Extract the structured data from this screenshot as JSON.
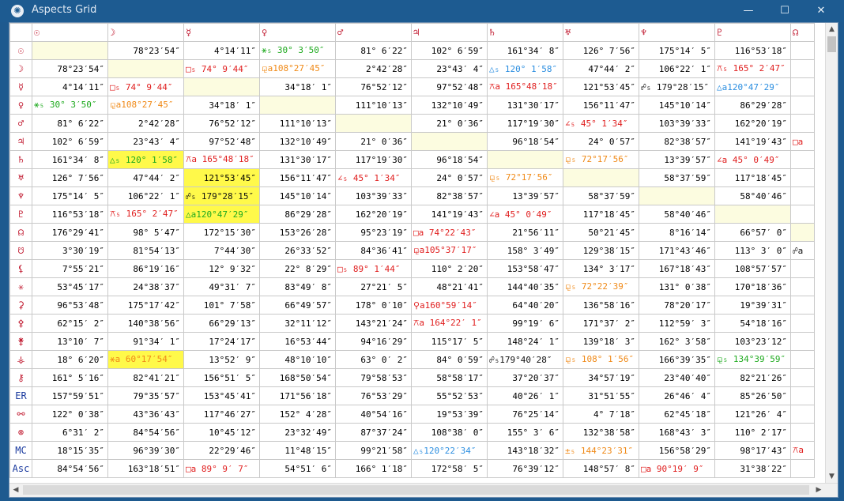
{
  "window": {
    "title": "Aspects Grid",
    "minimize": "—",
    "maximize": "☐",
    "close": "✕"
  },
  "colors": {
    "green": "#1faa1f",
    "red": "#e01e1e",
    "blue": "#2b8ee0",
    "orange": "#f08a18",
    "highlight": "#fff94a",
    "diagonal": "#fcfce0"
  },
  "columns": [
    "☉",
    "☽",
    "☿",
    "♀",
    "♂",
    "♃",
    "♄",
    "♅",
    "♆",
    "♇",
    "☊"
  ],
  "rows": [
    {
      "h": "☉",
      "c": [
        {
          "e": 1
        },
        {
          "t": "78°23′54″"
        },
        {
          "t": "4°14′11″"
        },
        {
          "t": "⚹₅ 30° 3′50″",
          "k": "green",
          "a": 1
        },
        {
          "t": "81° 6′22″"
        },
        {
          "t": "102° 6′59″"
        },
        {
          "t": "161°34′ 8″"
        },
        {
          "t": "126° 7′56″"
        },
        {
          "t": "175°14′ 5″"
        },
        {
          "t": "116°53′18″"
        },
        {
          "t": ""
        }
      ]
    },
    {
      "h": "☽",
      "c": [
        {
          "t": "78°23′54″"
        },
        {
          "e": 1
        },
        {
          "t": "□₅ 74° 9′44″",
          "k": "red",
          "a": 1
        },
        {
          "t": "⚼a108°27′45″",
          "k": "orange",
          "a": 1
        },
        {
          "t": "2°42′28″"
        },
        {
          "t": "23°43′ 4″"
        },
        {
          "t": "△₅ 120° 1′58″",
          "k": "blue",
          "a": 1
        },
        {
          "t": "47°44′ 2″"
        },
        {
          "t": "106°22′ 1″"
        },
        {
          "t": "⚻₅ 165° 2′47″",
          "k": "red",
          "a": 1
        },
        {
          "t": ""
        }
      ]
    },
    {
      "h": "☿",
      "c": [
        {
          "t": "4°14′11″"
        },
        {
          "t": "□₅ 74° 9′44″",
          "k": "red",
          "a": 1
        },
        {
          "e": 1
        },
        {
          "t": "34°18′ 1″"
        },
        {
          "t": "76°52′12″"
        },
        {
          "t": "97°52′48″"
        },
        {
          "t": "⚻a 165°48′18″",
          "k": "red",
          "a": 1
        },
        {
          "t": "121°53′45″"
        },
        {
          "t": "☍₅ 179°28′15″",
          "k": "black",
          "a": 1
        },
        {
          "t": "△a120°47′29″",
          "k": "blue",
          "a": 1
        },
        {
          "t": ""
        }
      ]
    },
    {
      "h": "♀",
      "c": [
        {
          "t": "⚹₅ 30° 3′50″",
          "k": "green",
          "a": 1
        },
        {
          "t": "⚼a108°27′45″",
          "k": "orange",
          "a": 1
        },
        {
          "t": "34°18′ 1″"
        },
        {
          "e": 1
        },
        {
          "t": "111°10′13″"
        },
        {
          "t": "132°10′49″"
        },
        {
          "t": "131°30′17″"
        },
        {
          "t": "156°11′47″"
        },
        {
          "t": "145°10′14″"
        },
        {
          "t": "86°29′28″"
        },
        {
          "t": ""
        }
      ]
    },
    {
      "h": "♂",
      "c": [
        {
          "t": "81° 6′22″"
        },
        {
          "t": "2°42′28″"
        },
        {
          "t": "76°52′12″"
        },
        {
          "t": "111°10′13″"
        },
        {
          "e": 1
        },
        {
          "t": "21° 0′36″"
        },
        {
          "t": "117°19′30″"
        },
        {
          "t": "∠₅ 45° 1′34″",
          "k": "red",
          "a": 1
        },
        {
          "t": "103°39′33″"
        },
        {
          "t": "162°20′19″"
        },
        {
          "t": ""
        }
      ]
    },
    {
      "h": "♃",
      "c": [
        {
          "t": "102° 6′59″"
        },
        {
          "t": "23°43′ 4″"
        },
        {
          "t": "97°52′48″"
        },
        {
          "t": "132°10′49″"
        },
        {
          "t": "21° 0′36″"
        },
        {
          "e": 1
        },
        {
          "t": "96°18′54″"
        },
        {
          "t": "24° 0′57″"
        },
        {
          "t": "82°38′57″"
        },
        {
          "t": "141°19′43″"
        },
        {
          "t": "□a",
          "k": "red",
          "a": 1
        }
      ]
    },
    {
      "h": "♄",
      "c": [
        {
          "t": "161°34′ 8″"
        },
        {
          "t": "△₅ 120° 1′58″",
          "k": "green",
          "a": 1,
          "hl": 1
        },
        {
          "t": "⚻a 165°48′18″",
          "k": "red",
          "a": 1
        },
        {
          "t": "131°30′17″"
        },
        {
          "t": "117°19′30″"
        },
        {
          "t": "96°18′54″"
        },
        {
          "e": 1
        },
        {
          "t": "⚼₅ 72°17′56″",
          "k": "orange",
          "a": 1
        },
        {
          "t": "13°39′57″"
        },
        {
          "t": "∠a 45° 0′49″",
          "k": "red",
          "a": 1
        },
        {
          "t": ""
        }
      ]
    },
    {
      "h": "♅",
      "c": [
        {
          "t": "126° 7′56″"
        },
        {
          "t": "47°44′ 2″"
        },
        {
          "t": "121°53′45″",
          "hl": 1
        },
        {
          "t": "156°11′47″"
        },
        {
          "t": "∠₅ 45° 1′34″",
          "k": "red",
          "a": 1
        },
        {
          "t": "24° 0′57″"
        },
        {
          "t": "⚼₅ 72°17′56″",
          "k": "orange",
          "a": 1
        },
        {
          "e": 1
        },
        {
          "t": "58°37′59″"
        },
        {
          "t": "117°18′45″"
        },
        {
          "t": ""
        }
      ]
    },
    {
      "h": "♆",
      "c": [
        {
          "t": "175°14′ 5″"
        },
        {
          "t": "106°22′ 1″"
        },
        {
          "t": "☍₅ 179°28′15″",
          "k": "black",
          "a": 1,
          "hl": 1
        },
        {
          "t": "145°10′14″"
        },
        {
          "t": "103°39′33″"
        },
        {
          "t": "82°38′57″"
        },
        {
          "t": "13°39′57″"
        },
        {
          "t": "58°37′59″"
        },
        {
          "e": 1
        },
        {
          "t": "58°40′46″"
        },
        {
          "t": ""
        }
      ]
    },
    {
      "h": "♇",
      "c": [
        {
          "t": "116°53′18″"
        },
        {
          "t": "⚻₅ 165° 2′47″",
          "k": "red",
          "a": 1
        },
        {
          "t": "△a120°47′29″",
          "k": "green",
          "a": 1,
          "hl": 1
        },
        {
          "t": "86°29′28″"
        },
        {
          "t": "162°20′19″"
        },
        {
          "t": "141°19′43″"
        },
        {
          "t": "∠a 45° 0′49″",
          "k": "red",
          "a": 1
        },
        {
          "t": "117°18′45″"
        },
        {
          "t": "58°40′46″"
        },
        {
          "e": 1
        },
        {
          "t": ""
        }
      ]
    },
    {
      "h": "☊",
      "c": [
        {
          "t": "176°29′41″"
        },
        {
          "t": "98° 5′47″"
        },
        {
          "t": "172°15′30″"
        },
        {
          "t": "153°26′28″"
        },
        {
          "t": "95°23′19″"
        },
        {
          "t": "□a 74°22′43″",
          "k": "red",
          "a": 1
        },
        {
          "t": "21°56′11″"
        },
        {
          "t": "50°21′45″"
        },
        {
          "t": "8°16′14″"
        },
        {
          "t": "66°57′ 0″"
        },
        {
          "e": 1
        }
      ]
    },
    {
      "h": "☋",
      "c": [
        {
          "t": "3°30′19″"
        },
        {
          "t": "81°54′13″"
        },
        {
          "t": "7°44′30″"
        },
        {
          "t": "26°33′52″"
        },
        {
          "t": "84°36′41″"
        },
        {
          "t": "⚼a105°37′17″",
          "k": "red",
          "a": 1
        },
        {
          "t": "158° 3′49″"
        },
        {
          "t": "129°38′15″"
        },
        {
          "t": "171°43′46″"
        },
        {
          "t": "113° 3′ 0″"
        },
        {
          "t": "☍a",
          "k": "black",
          "a": 1
        }
      ]
    },
    {
      "h": "⚸",
      "c": [
        {
          "t": "7°55′21″"
        },
        {
          "t": "86°19′16″"
        },
        {
          "t": "12° 9′32″"
        },
        {
          "t": "22° 8′29″"
        },
        {
          "t": "□₅ 89° 1′44″",
          "k": "red",
          "a": 1
        },
        {
          "t": "110° 2′20″"
        },
        {
          "t": "153°58′47″"
        },
        {
          "t": "134° 3′17″"
        },
        {
          "t": "167°18′43″"
        },
        {
          "t": "108°57′57″"
        },
        {
          "t": ""
        }
      ]
    },
    {
      "h": "✳",
      "c": [
        {
          "t": "53°45′17″"
        },
        {
          "t": "24°38′37″"
        },
        {
          "t": "49°31′ 7″"
        },
        {
          "t": "83°49′ 8″"
        },
        {
          "t": "27°21′ 5″"
        },
        {
          "t": "48°21′41″"
        },
        {
          "t": "144°40′35″"
        },
        {
          "t": "⚼₅ 72°22′39″",
          "k": "orange",
          "a": 1
        },
        {
          "t": "131° 0′38″"
        },
        {
          "t": "170°18′36″"
        },
        {
          "t": ""
        }
      ]
    },
    {
      "h": "⚳",
      "c": [
        {
          "t": "96°53′48″"
        },
        {
          "t": "175°17′42″"
        },
        {
          "t": "101° 7′58″"
        },
        {
          "t": "66°49′57″"
        },
        {
          "t": "178° 0′10″"
        },
        {
          "t": "⚲a160°59′14″",
          "k": "red",
          "a": 1
        },
        {
          "t": "64°40′20″"
        },
        {
          "t": "136°58′16″"
        },
        {
          "t": "78°20′17″"
        },
        {
          "t": "19°39′31″"
        },
        {
          "t": ""
        }
      ]
    },
    {
      "h": "⚴",
      "c": [
        {
          "t": "62°15′ 2″"
        },
        {
          "t": "140°38′56″"
        },
        {
          "t": "66°29′13″"
        },
        {
          "t": "32°11′12″"
        },
        {
          "t": "143°21′24″"
        },
        {
          "t": "⚻a 164°22′ 1″",
          "k": "red",
          "a": 1
        },
        {
          "t": "99°19′ 6″"
        },
        {
          "t": "171°37′ 2″"
        },
        {
          "t": "112°59′ 3″"
        },
        {
          "t": "54°18′16″"
        },
        {
          "t": ""
        }
      ]
    },
    {
      "h": "⚵",
      "c": [
        {
          "t": "13°10′ 7″"
        },
        {
          "t": "91°34′ 1″"
        },
        {
          "t": "17°24′17″"
        },
        {
          "t": "16°53′44″"
        },
        {
          "t": "94°16′29″"
        },
        {
          "t": "115°17′ 5″"
        },
        {
          "t": "148°24′ 1″"
        },
        {
          "t": "139°18′ 3″"
        },
        {
          "t": "162° 3′58″"
        },
        {
          "t": "103°23′12″"
        },
        {
          "t": ""
        }
      ]
    },
    {
      "h": "⚶",
      "c": [
        {
          "t": "18° 6′20″"
        },
        {
          "t": "⚹a 60°17′54″",
          "k": "orange",
          "a": 1,
          "hl": 1
        },
        {
          "t": "13°52′ 9″"
        },
        {
          "t": "48°10′10″"
        },
        {
          "t": "63° 0′ 2″"
        },
        {
          "t": "84° 0′59″"
        },
        {
          "t": "☍₅179°40′28″",
          "k": "black",
          "a": 1
        },
        {
          "t": "⚼₅ 108° 1′56″",
          "k": "orange",
          "a": 1
        },
        {
          "t": "166°39′35″"
        },
        {
          "t": "⚼₅ 134°39′59″",
          "k": "green",
          "a": 1
        },
        {
          "t": ""
        }
      ]
    },
    {
      "h": "⚷",
      "c": [
        {
          "t": "161° 5′16″"
        },
        {
          "t": "82°41′21″"
        },
        {
          "t": "156°51′ 5″"
        },
        {
          "t": "168°50′54″"
        },
        {
          "t": "79°58′53″"
        },
        {
          "t": "58°58′17″"
        },
        {
          "t": "37°20′37″"
        },
        {
          "t": "34°57′19″"
        },
        {
          "t": "23°40′40″"
        },
        {
          "t": "82°21′26″"
        },
        {
          "t": ""
        }
      ]
    },
    {
      "h": "ER",
      "c": [
        {
          "t": "157°59′51″"
        },
        {
          "t": "79°35′57″"
        },
        {
          "t": "153°45′41″"
        },
        {
          "t": "171°56′18″"
        },
        {
          "t": "76°53′29″"
        },
        {
          "t": "55°52′53″"
        },
        {
          "t": "40°26′ 1″"
        },
        {
          "t": "31°51′55″"
        },
        {
          "t": "26°46′ 4″"
        },
        {
          "t": "85°26′50″"
        },
        {
          "t": ""
        }
      ]
    },
    {
      "h": "⚯",
      "c": [
        {
          "t": "122° 0′38″"
        },
        {
          "t": "43°36′43″"
        },
        {
          "t": "117°46′27″"
        },
        {
          "t": "152° 4′28″"
        },
        {
          "t": "40°54′16″"
        },
        {
          "t": "19°53′39″"
        },
        {
          "t": "76°25′14″"
        },
        {
          "t": "4° 7′18″"
        },
        {
          "t": "62°45′18″"
        },
        {
          "t": "121°26′ 4″"
        },
        {
          "t": ""
        }
      ]
    },
    {
      "h": "⊗",
      "c": [
        {
          "t": "6°31′ 2″"
        },
        {
          "t": "84°54′56″"
        },
        {
          "t": "10°45′12″"
        },
        {
          "t": "23°32′49″"
        },
        {
          "t": "87°37′24″"
        },
        {
          "t": "108°38′ 0″"
        },
        {
          "t": "155° 3′ 6″"
        },
        {
          "t": "132°38′58″"
        },
        {
          "t": "168°43′ 3″"
        },
        {
          "t": "110° 2′17″"
        },
        {
          "t": ""
        }
      ]
    },
    {
      "h": "MC",
      "c": [
        {
          "t": "18°15′35″"
        },
        {
          "t": "96°39′30″"
        },
        {
          "t": "22°29′46″"
        },
        {
          "t": "11°48′15″"
        },
        {
          "t": "99°21′58″"
        },
        {
          "t": "△₅120°22′34″",
          "k": "blue",
          "a": 1
        },
        {
          "t": "143°18′32″"
        },
        {
          "t": "±₅ 144°23′31″",
          "k": "orange",
          "a": 1
        },
        {
          "t": "156°58′29″"
        },
        {
          "t": "98°17′43″"
        },
        {
          "t": "⚻a",
          "k": "red",
          "a": 1
        }
      ]
    },
    {
      "h": "Asc",
      "c": [
        {
          "t": "84°54′56″"
        },
        {
          "t": "163°18′51″"
        },
        {
          "t": "□a 89° 9′ 7″",
          "k": "red",
          "a": 1
        },
        {
          "t": "54°51′ 6″"
        },
        {
          "t": "166° 1′18″"
        },
        {
          "t": "172°58′ 5″"
        },
        {
          "t": "76°39′12″"
        },
        {
          "t": "148°57′ 8″"
        },
        {
          "t": "□a 90°19′ 9″",
          "k": "red",
          "a": 1
        },
        {
          "t": "31°38′22″"
        },
        {
          "t": ""
        }
      ]
    }
  ]
}
